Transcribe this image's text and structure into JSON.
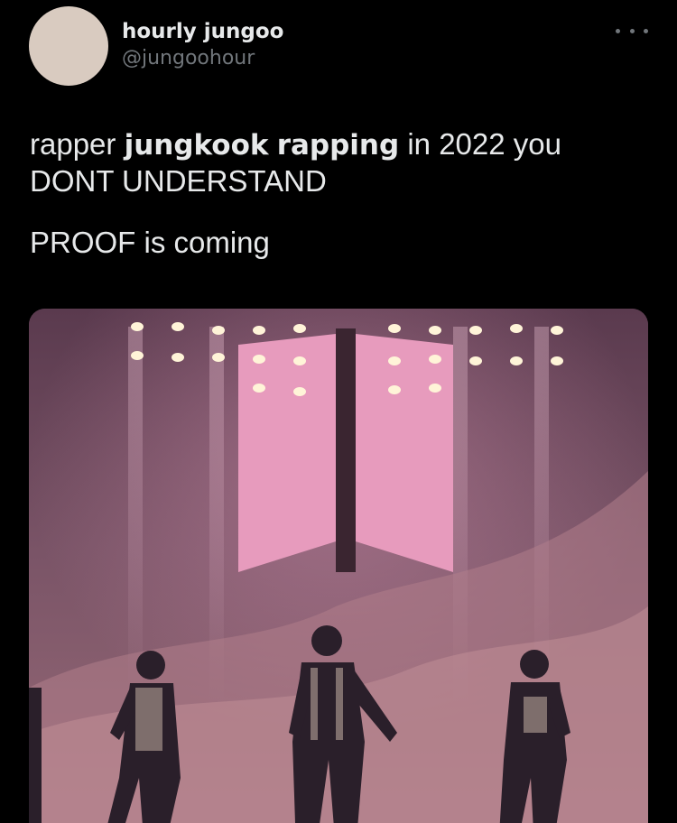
{
  "user": {
    "display_name": "hourly jungoo",
    "handle": "@jungoohour"
  },
  "tweet": {
    "line1_pre": "rapper ",
    "line1_bold1": "jungkook",
    "line1_mid": " ",
    "line1_bold2": "rapping",
    "line1_post": " in 2022 you",
    "line2": "DONT UNDERSTAND",
    "line3": "PROOF is coming"
  },
  "icons": {
    "more": "more-options-icon"
  },
  "colors": {
    "background": "#000000",
    "text": "#e7e9ea",
    "secondary_text": "#71767b",
    "stage_pink": "#e79bbd"
  }
}
